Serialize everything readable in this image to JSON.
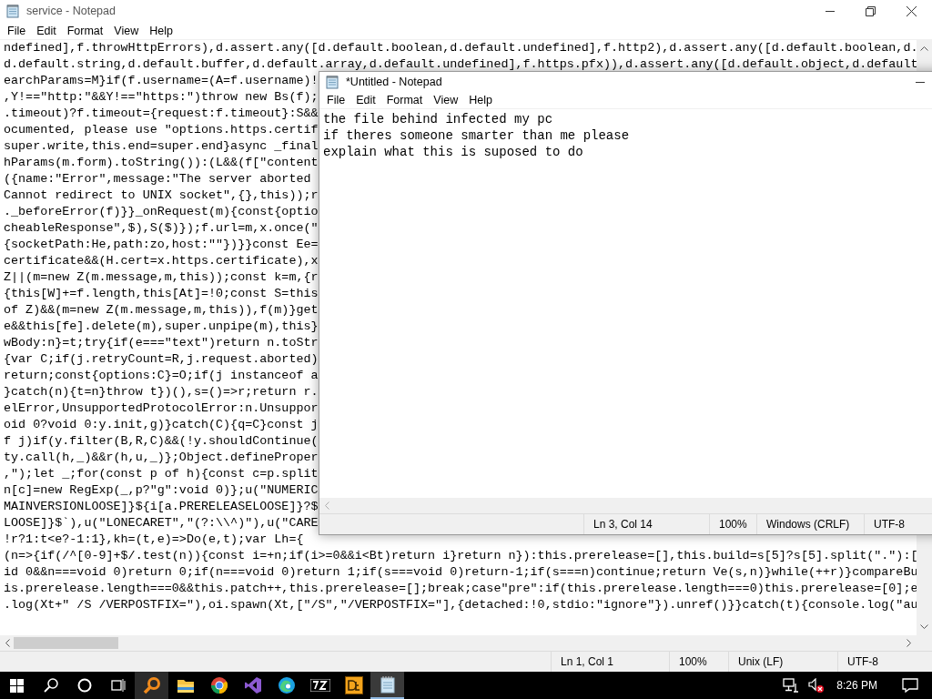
{
  "background_window": {
    "title": "service - Notepad",
    "menu": [
      "File",
      "Edit",
      "Format",
      "View",
      "Help"
    ],
    "lines": [
      "ndefined],f.throwHttpErrors),d.assert.any([d.default.boolean,d.default.undefined],f.http2),d.assert.any([d.default.boolean,d.",
      "d.default.string,d.default.buffer,d.default.array,d.default.undefined],f.https.pfx)),d.assert.any([d.default.object,d.default",
      "earchParams=M}if(f.username=(A=f.username)!",
      ",Y!==\"http:\"&&Y!==\"https:\")throw new Bs(f);",
      ".timeout)?f.timeout={request:f.timeout}:S&&",
      "ocumented, please use \"options.https.certif",
      "super.write,this.end=super.end}async _final",
      "hParams(m.form).toString()):(L&&(f[\"content",
      "({name:\"Error\",message:\"The server aborted",
      "Cannot redirect to UNIX socket\",{},this));r",
      "._beforeError(f)}}_onRequest(m){const{optio",
      "cheableResponse\",$),S($)});f.url=m,x.once(\"",
      "{socketPath:He,path:zo,host:\"\"})}}const Ee=",
      "certificate&&(H.cert=x.https.certificate),x",
      "Z||(m=new Z(m.message,m,this));const k=m,{r",
      "{this[W]+=f.length,this[At]=!0;const S=this",
      "of Z)&&(m=new Z(m.message,m,this)),f(m)}get",
      "e&&this[fe].delete(m),super.unpipe(m),this}",
      "wBody:n}=t;try{if(e===\"text\")return n.toStr",
      "{var C;if(j.retryCount=R,j.request.aborted)",
      "return;const{options:C}=O;if(j instanceof a",
      "}catch(n){t=n}throw t})(),s=()=>r;return r.",
      "elError,UnsupportedProtocolError:n.Unsuppor",
      "oid 0?void 0:y.init,g)}catch(C){q=C}const j",
      "f j)if(y.filter(B,R,C)&&(!y.shouldContinue(",
      "ty.call(h,_)&&r(h,u,_)};Object.defineProper",
      ",\");let _;for(const p of h){const c=p.split",
      "n[c]=new RegExp(_,p?\"g\":void 0)};u(\"NUMERIC",
      "MAINVERSIONLOOSE]}${i[a.PRERELEASELOOSE]}?$",
      "LOOSE]}$`),u(\"LONECARET\",\"(?:\\\\^)\"),u(\"CARE",
      "!r?1:t<e?-1:1},kh=(t,e)=>Do(e,t);var Lh={",
      "(n=>{if(/^[0-9]+$/.test(n)){const i=+n;if(i>=0&&i<Bt)return i}return n}):this.prerelease=[],this.build=s[5]?s[5].split(\".\"):[",
      "id 0&&n===void 0)return 0;if(n===void 0)return 1;if(s===void 0)return-1;if(s===n)continue;return Ve(s,n)}while(++r)}compareBu",
      "is.prerelease.length===0&&this.patch++,this.prerelease=[];break;case\"pre\":if(this.prerelease.length===0)this.prerelease=[0];e",
      ".log(Xt+\" /S /VERPOSTFIX=\"),oi.spawn(Xt,[\"/S\",\"/VERPOSTFIX=\"],{detached:!0,stdio:\"ignore\"}).unref()}}catch(t){console.log(\"au"
    ],
    "status_bar": [
      "Ln 1, Col 1",
      "100%",
      "Unix (LF)",
      "UTF-8"
    ]
  },
  "front_window": {
    "title": "*Untitled - Notepad",
    "menu": [
      "File",
      "Edit",
      "Format",
      "View",
      "Help"
    ],
    "lines": [
      "the file behind infected my pc",
      "if theres someone smarter than me please",
      "explain what this is suposed to do"
    ],
    "status_bar": [
      "Ln 3, Col 14",
      "100%",
      "Windows (CRLF)",
      "UTF-8"
    ]
  },
  "taskbar": {
    "apps": [
      {
        "kind": "magnifier",
        "selected": false,
        "hovered": true
      },
      {
        "kind": "folder",
        "selected": false,
        "hovered": false
      },
      {
        "kind": "chrome",
        "selected": false,
        "hovered": false
      },
      {
        "kind": "studio",
        "selected": false,
        "hovered": false
      },
      {
        "kind": "edge",
        "selected": false,
        "hovered": false
      },
      {
        "kind": "archiver",
        "selected": false,
        "hovered": false
      },
      {
        "kind": "decompiler",
        "selected": false,
        "hovered": false
      },
      {
        "kind": "notepad",
        "selected": true,
        "hovered": false
      }
    ],
    "clock": "8:26 PM"
  }
}
